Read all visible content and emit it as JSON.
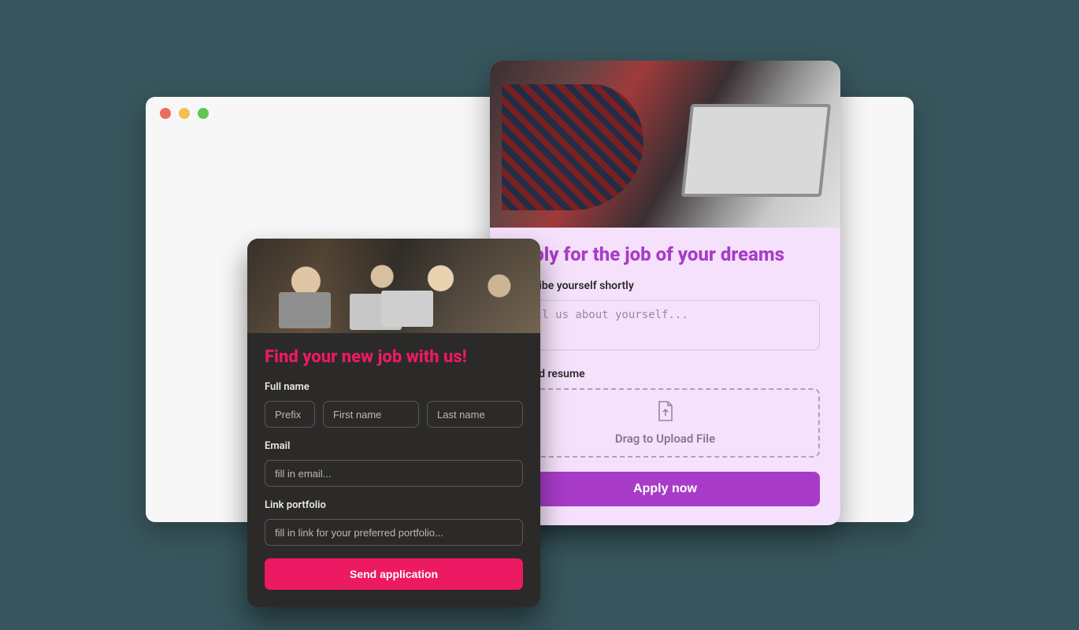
{
  "browser": {
    "dots": [
      "red",
      "yellow",
      "green"
    ]
  },
  "card_purple": {
    "title": "Apply for the job of your dreams",
    "describe_label": "Describe yourself shortly",
    "describe_placeholder": "Tell us about yourself...",
    "upload_label": "Upload resume",
    "dropzone_text": "Drag to Upload File",
    "submit_label": "Apply now",
    "accent": "#a83cc8",
    "bg": "#f5e1fb"
  },
  "card_dark": {
    "title": "Find your new job with us!",
    "fullname_label": "Full name",
    "prefix_placeholder": "Prefix",
    "first_placeholder": "First name",
    "last_placeholder": "Last name",
    "email_label": "Email",
    "email_placeholder": "fill in email...",
    "portfolio_label": "Link portfolio",
    "portfolio_placeholder": "fill in link for your preferred portfolio...",
    "submit_label": "Send application",
    "accent": "#ec1a62",
    "bg": "#2b2a29"
  }
}
